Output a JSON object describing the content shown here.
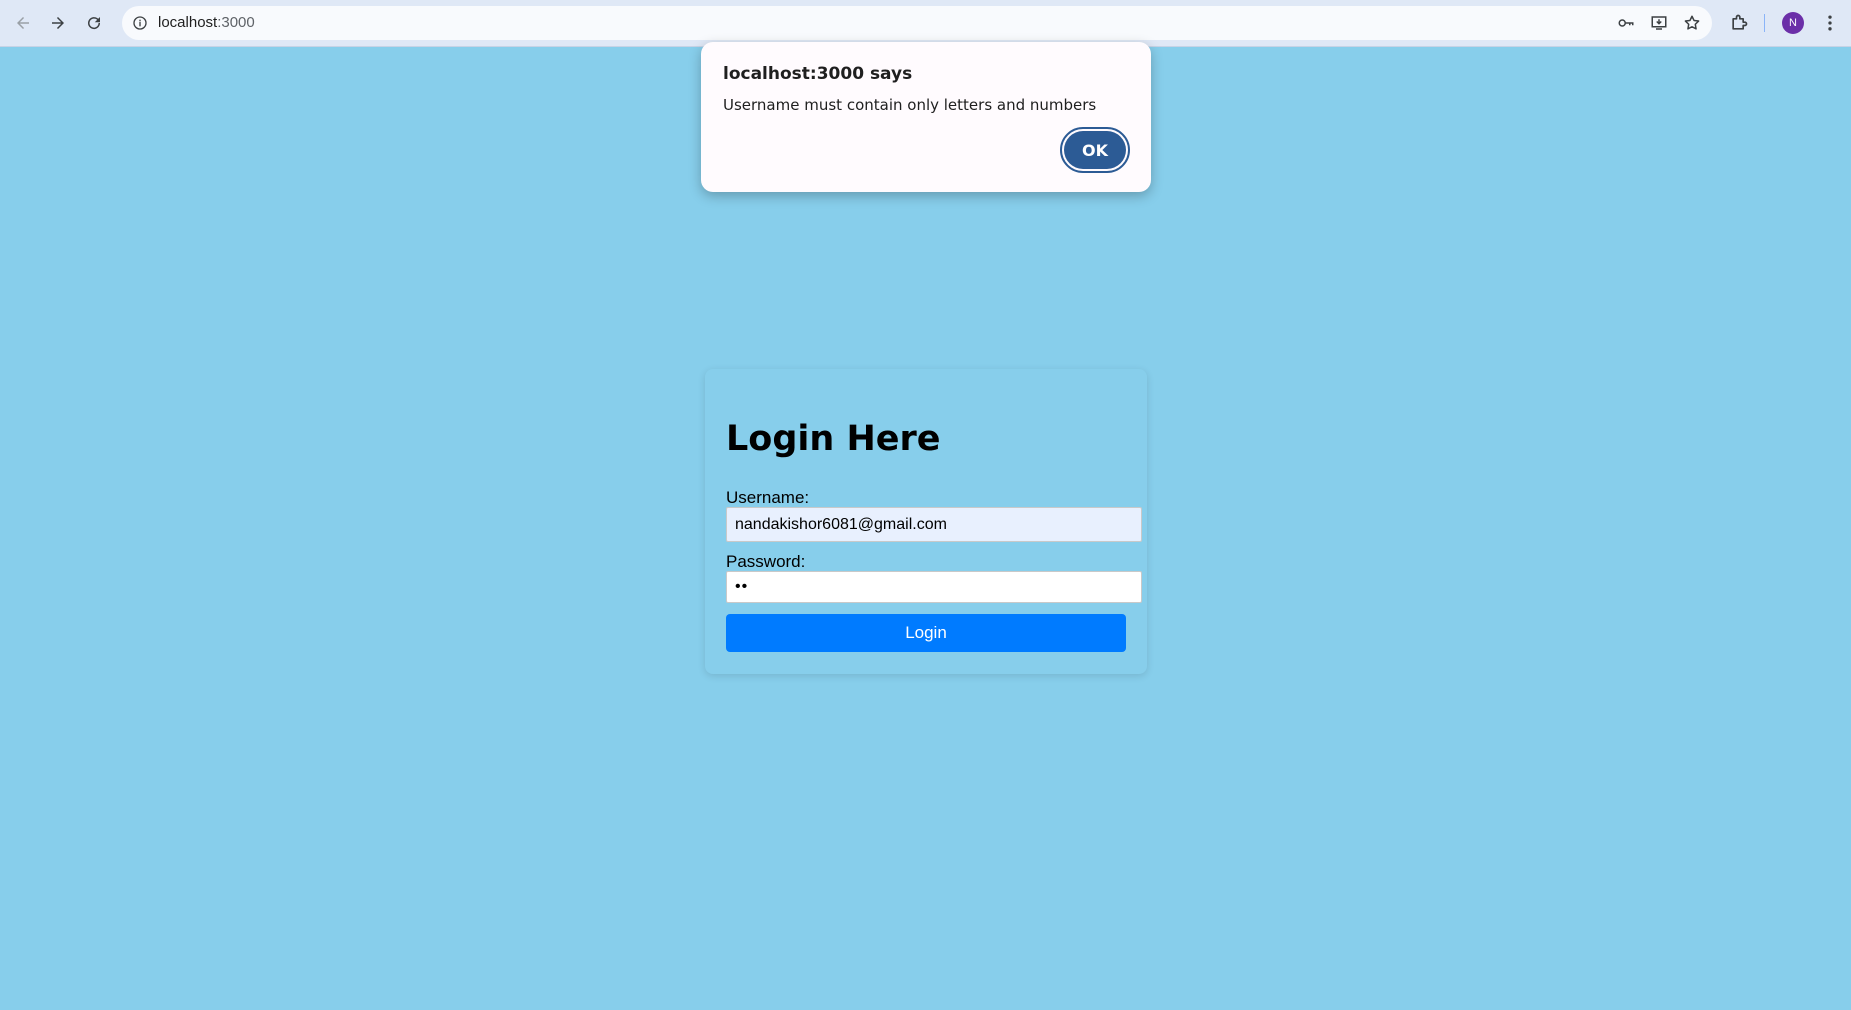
{
  "browser": {
    "url_host": "localhost",
    "url_port": ":3000",
    "avatar_initial": "N"
  },
  "dialog": {
    "title": "localhost:3000 says",
    "message": "Username must contain only letters and numbers",
    "ok_label": "OK"
  },
  "login": {
    "heading": "Login Here",
    "username_label": "Username:",
    "username_value": "nandakishor6081@gmail.com",
    "password_label": "Password:",
    "password_value": "••",
    "submit_label": "Login"
  },
  "colors": {
    "page_background": "#87ceeb",
    "login_button": "#007bff",
    "dialog_ok_button": "#2c5b95",
    "avatar": "#6b2fa8"
  }
}
